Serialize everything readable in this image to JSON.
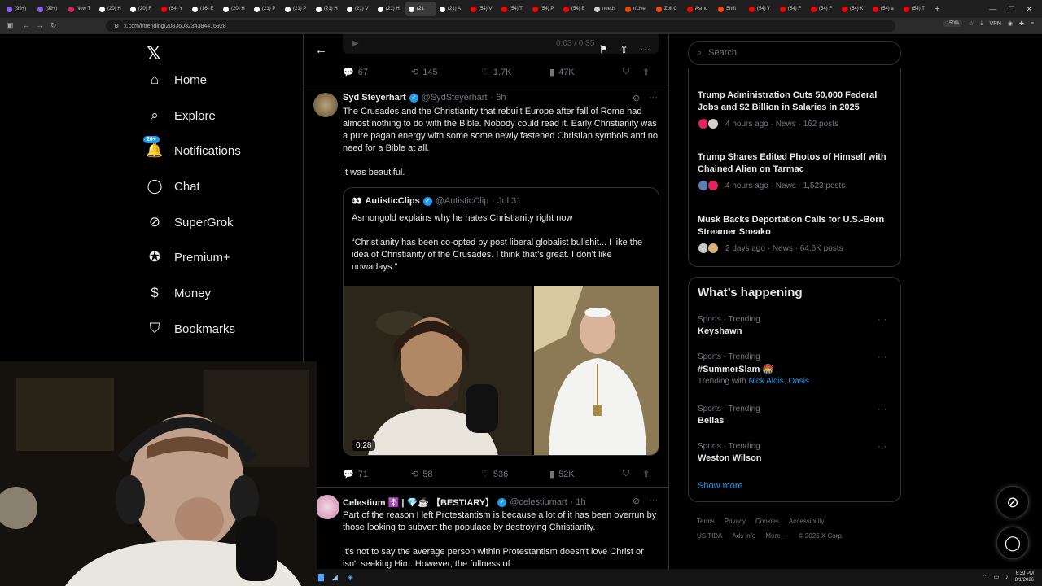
{
  "browser": {
    "tabs": [
      {
        "label": "(99+)",
        "color": "#8e5cf6"
      },
      {
        "label": "(99+)",
        "color": "#8e5cf6"
      },
      {
        "label": "New T",
        "color": "#e0245e"
      },
      {
        "label": "(20) H",
        "color": "#ffffff"
      },
      {
        "label": "(20) F",
        "color": "#ffffff"
      },
      {
        "label": "(54) Y",
        "color": "#ff0000"
      },
      {
        "label": "(16) E",
        "color": "#ffffff"
      },
      {
        "label": "(20) H",
        "color": "#ffffff"
      },
      {
        "label": "(21) P",
        "color": "#ffffff"
      },
      {
        "label": "(21) P",
        "color": "#ffffff"
      },
      {
        "label": "(21) H",
        "color": "#ffffff"
      },
      {
        "label": "(21) V",
        "color": "#ffffff"
      },
      {
        "label": "(21) H",
        "color": "#ffffff"
      },
      {
        "label": "(21",
        "color": "#ffffff",
        "active": true
      },
      {
        "label": "(21) A",
        "color": "#ffffff"
      },
      {
        "label": "(54) V",
        "color": "#ff0000"
      },
      {
        "label": "(54) Ti",
        "color": "#ff0000"
      },
      {
        "label": "(54) P",
        "color": "#ff0000"
      },
      {
        "label": "(54) E",
        "color": "#ff0000"
      },
      {
        "label": "needs",
        "color": "#cccccc"
      },
      {
        "label": "r/Live",
        "color": "#ff4500"
      },
      {
        "label": "Zoll C",
        "color": "#ff4500"
      },
      {
        "label": "Asmo",
        "color": "#ff0000"
      },
      {
        "label": "Shift",
        "color": "#ff4500"
      },
      {
        "label": "(54) Y",
        "color": "#ff0000"
      },
      {
        "label": "(54) F",
        "color": "#ff0000"
      },
      {
        "label": "(54) F",
        "color": "#ff0000"
      },
      {
        "label": "(54) K",
        "color": "#ff0000"
      },
      {
        "label": "(54) a",
        "color": "#ff0000"
      },
      {
        "label": "(54) T",
        "color": "#ff0000"
      }
    ],
    "url": "x.com/i/trending/2083603234384416928",
    "zoom": "150%",
    "vpn_label": "VPN"
  },
  "nav": {
    "items": [
      {
        "label": "Home",
        "icon": "home-icon"
      },
      {
        "label": "Explore",
        "icon": "search-icon"
      },
      {
        "label": "Notifications",
        "icon": "bell-icon",
        "badge": "20+"
      },
      {
        "label": "Chat",
        "icon": "chat-icon"
      },
      {
        "label": "SuperGrok",
        "icon": "grok-icon"
      },
      {
        "label": "Premium+",
        "icon": "premium-icon"
      },
      {
        "label": "Money",
        "icon": "money-icon"
      },
      {
        "label": "Bookmarks",
        "icon": "bookmark-icon"
      }
    ]
  },
  "video_time": "0:03 / 0:35",
  "top_post_stats": {
    "replies": "67",
    "reposts": "145",
    "likes": "1.7K",
    "views": "47K"
  },
  "post1": {
    "name": "Syd Steyerhart",
    "handle": "@SydSteyerhart",
    "time": "· 6h",
    "text": "The Crusades and the Christianity that rebuilt Europe after fall of Rome had almost nothing to do with the Bible. Nobody could read it. Early Christianity was a pure pagan energy with some some newly fastened Christian symbols and no need for a Bible at all.\n\nIt was beautiful.",
    "quote": {
      "name": "AutisticClips",
      "handle": "@AutisticClip",
      "time": "· Jul 31",
      "text1": "Asmongold explains why he hates Christianity right now",
      "text2": "“Christianity has been co-opted by post liberal globalist bullshit... I like the idea of Christianity of the Crusades. I think that’s great. I don’t like nowadays.”",
      "duration": "0:28"
    },
    "stats": {
      "replies": "71",
      "reposts": "58",
      "likes": "536",
      "views": "52K"
    }
  },
  "post2": {
    "name": "Celestium ☦️ | 💎☕ 【BESTIARY】",
    "handle": "@celestiumart",
    "time": "· 1h",
    "text": "Part of the reason I left Protestantism is because a lot of it has been overrun by those looking to subvert the populace by destroying Christianity.\n\nIt's not to say the average person within Protestantism doesn't love Christ or isn't seeking Him. However, the fullness of"
  },
  "search": {
    "placeholder": "Search"
  },
  "news": [
    {
      "title": "Trump Administration Cuts 50,000 Federal Jobs and $2 Billion in Salaries in 2025",
      "meta": "4 hours ago · News · 162 posts"
    },
    {
      "title": "Trump Shares Edited Photos of Himself with Chained Alien on Tarmac",
      "meta": "4 hours ago · News · 1,523 posts"
    },
    {
      "title": "Musk Backs Deportation Calls for U.S.-Born Streamer Sneako",
      "meta": "2 days ago · News · 64.6K posts"
    }
  ],
  "happening": {
    "title": "What’s happening",
    "trends": [
      {
        "category": "Sports · Trending",
        "name": "Keyshawn"
      },
      {
        "category": "Sports · Trending",
        "name": "#SummerSlam 🏟️",
        "with_prefix": "Trending with",
        "with": "Nick Aldis, Oasis"
      },
      {
        "category": "Sports · Trending",
        "name": "Bellas"
      },
      {
        "category": "Sports · Trending",
        "name": "Weston Wilson"
      }
    ],
    "show_more": "Show more"
  },
  "footer": {
    "line1": [
      "Terms",
      "Privacy",
      "Cookies",
      "Accessibility"
    ],
    "line2": [
      "US TIDA",
      "Ads info",
      "More ···",
      "© 2026 X Corp."
    ]
  },
  "taskbar": {
    "time": "6:39 PM",
    "date": "8/1/2026"
  },
  "colors": {
    "accent": "#1d9bf0",
    "border": "#2f3336",
    "muted": "#71767b"
  }
}
